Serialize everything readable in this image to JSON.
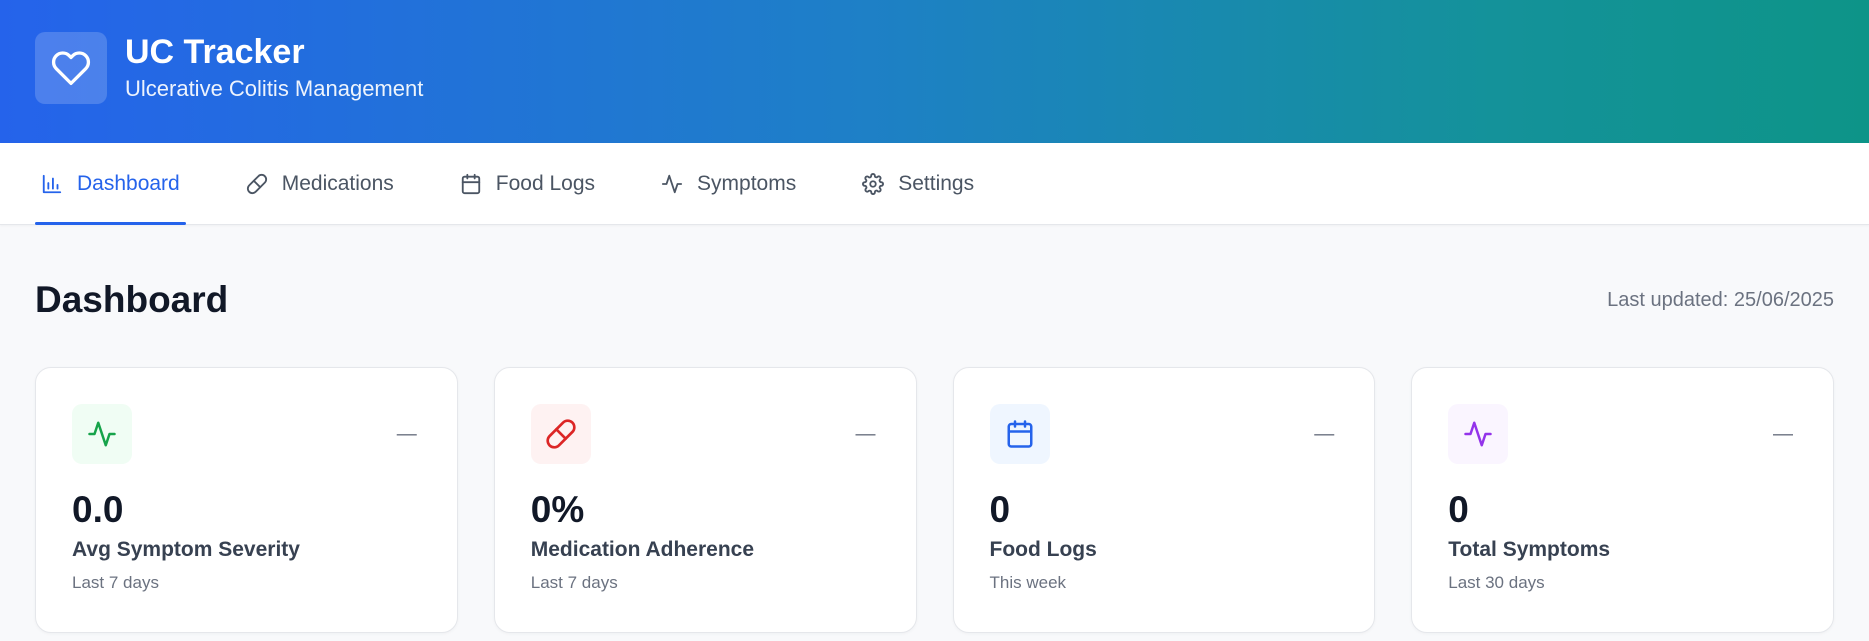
{
  "app": {
    "title": "UC Tracker",
    "subtitle": "Ulcerative Colitis Management",
    "logo_icon": "heart-icon"
  },
  "nav": {
    "items": [
      {
        "label": "Dashboard",
        "icon": "bar-chart-icon",
        "active": true
      },
      {
        "label": "Medications",
        "icon": "pill-icon",
        "active": false
      },
      {
        "label": "Food Logs",
        "icon": "calendar-icon",
        "active": false
      },
      {
        "label": "Symptoms",
        "icon": "activity-icon",
        "active": false
      },
      {
        "label": "Settings",
        "icon": "gear-icon",
        "active": false
      }
    ]
  },
  "page": {
    "title": "Dashboard",
    "last_updated": "Last updated: 25/06/2025"
  },
  "cards": [
    {
      "value": "0.0",
      "label": "Avg Symptom Severity",
      "sub": "Last 7 days",
      "trend": "—",
      "icon": "activity-icon",
      "color": "#16a34a",
      "bg": "#f0fdf4"
    },
    {
      "value": "0%",
      "label": "Medication Adherence",
      "sub": "Last 7 days",
      "trend": "—",
      "icon": "pill-icon",
      "color": "#dc2626",
      "bg": "#fef2f2"
    },
    {
      "value": "0",
      "label": "Food Logs",
      "sub": "This week",
      "trend": "—",
      "icon": "calendar-icon",
      "color": "#2563eb",
      "bg": "#eff6ff"
    },
    {
      "value": "0",
      "label": "Total Symptoms",
      "sub": "Last 30 days",
      "trend": "—",
      "icon": "activity-icon",
      "color": "#9333ea",
      "bg": "#faf5ff"
    }
  ],
  "colors": {
    "accent": "#2563eb",
    "header_gradient_start": "#2563eb",
    "header_gradient_end": "#0d9488"
  }
}
